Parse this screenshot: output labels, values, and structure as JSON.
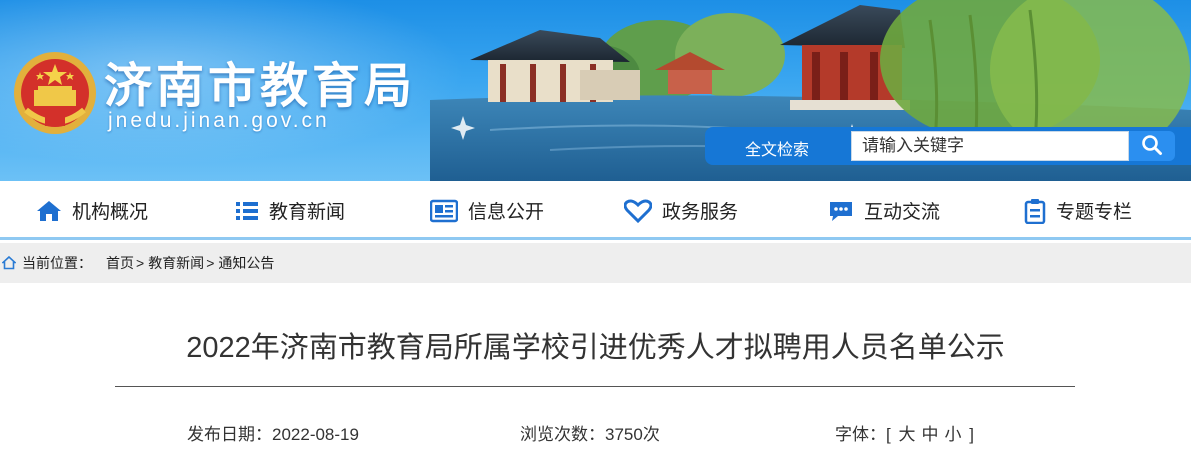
{
  "header": {
    "site_title": "济南市教育局",
    "site_domain": "jnedu.jinan.gov.cn",
    "search": {
      "label": "全文检索",
      "placeholder": "请输入关键字",
      "button_icon": "search-icon"
    },
    "colors": {
      "banner_top": "#1d8fe6",
      "banner_bottom": "#6cc1f6",
      "search_bar": "#1677d6",
      "nav_icon": "#1e6fd0"
    }
  },
  "nav": {
    "items": [
      {
        "label": "机构概况",
        "icon": "home-icon"
      },
      {
        "label": "教育新闻",
        "icon": "list-icon"
      },
      {
        "label": "信息公开",
        "icon": "newspaper-icon"
      },
      {
        "label": "政务服务",
        "icon": "heart-icon"
      },
      {
        "label": "互动交流",
        "icon": "chat-icon"
      },
      {
        "label": "专题专栏",
        "icon": "clipboard-icon"
      }
    ]
  },
  "breadcrumb": {
    "label": "当前位置：",
    "items": [
      "首页",
      "教育新闻",
      "通知公告"
    ],
    "separator": ">"
  },
  "article": {
    "title": "2022年济南市教育局所属学校引进优秀人才拟聘用人员名单公示",
    "publish_label": "发布日期：",
    "publish_date": "2022-08-19",
    "views_label": "浏览次数：",
    "views": "3750次",
    "font_label": "字体：",
    "font_open": "[",
    "font_large": "大",
    "font_medium": "中",
    "font_small": "小",
    "font_close": "]"
  }
}
